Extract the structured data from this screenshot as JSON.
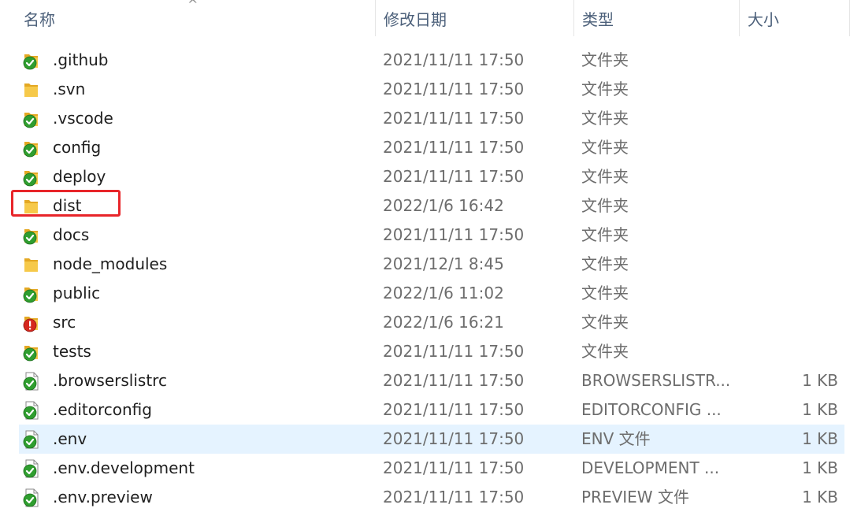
{
  "header": {
    "name": "名称",
    "date": "修改日期",
    "type": "类型",
    "size": "大小",
    "sort_arrow": "^"
  },
  "colors": {
    "folder": "#f6c94a",
    "folder_dark": "#e4a823",
    "status_ok": "#2f9e2f",
    "status_modified": "#d6281e",
    "selection": "#e5f3ff",
    "highlight_box": "#e8252a"
  },
  "rows": [
    {
      "name": ".github",
      "date": "2021/11/11 17:50",
      "type": "文件夹",
      "size": "",
      "kind": "folder",
      "status": "ok"
    },
    {
      "name": ".svn",
      "date": "2021/11/11 17:50",
      "type": "文件夹",
      "size": "",
      "kind": "folder",
      "status": "none"
    },
    {
      "name": ".vscode",
      "date": "2021/11/11 17:50",
      "type": "文件夹",
      "size": "",
      "kind": "folder",
      "status": "ok"
    },
    {
      "name": "config",
      "date": "2021/11/11 17:50",
      "type": "文件夹",
      "size": "",
      "kind": "folder",
      "status": "ok"
    },
    {
      "name": "deploy",
      "date": "2021/11/11 17:50",
      "type": "文件夹",
      "size": "",
      "kind": "folder",
      "status": "ok"
    },
    {
      "name": "dist",
      "date": "2022/1/6 16:42",
      "type": "文件夹",
      "size": "",
      "kind": "folder",
      "status": "none"
    },
    {
      "name": "docs",
      "date": "2021/11/11 17:50",
      "type": "文件夹",
      "size": "",
      "kind": "folder",
      "status": "ok"
    },
    {
      "name": "node_modules",
      "date": "2021/12/1 8:45",
      "type": "文件夹",
      "size": "",
      "kind": "folder",
      "status": "none"
    },
    {
      "name": "public",
      "date": "2022/1/6 11:02",
      "type": "文件夹",
      "size": "",
      "kind": "folder",
      "status": "ok"
    },
    {
      "name": "src",
      "date": "2022/1/6 16:21",
      "type": "文件夹",
      "size": "",
      "kind": "folder",
      "status": "modified"
    },
    {
      "name": "tests",
      "date": "2021/11/11 17:50",
      "type": "文件夹",
      "size": "",
      "kind": "folder",
      "status": "ok"
    },
    {
      "name": ".browserslistrc",
      "date": "2021/11/11 17:50",
      "type": "BROWSERSLISTR...",
      "size": "1 KB",
      "kind": "file",
      "status": "ok"
    },
    {
      "name": ".editorconfig",
      "date": "2021/11/11 17:50",
      "type": "EDITORCONFIG ...",
      "size": "1 KB",
      "kind": "file",
      "status": "ok"
    },
    {
      "name": ".env",
      "date": "2021/11/11 17:50",
      "type": "ENV 文件",
      "size": "1 KB",
      "kind": "file",
      "status": "ok",
      "selected": true
    },
    {
      "name": ".env.development",
      "date": "2021/11/11 17:50",
      "type": "DEVELOPMENT ...",
      "size": "1 KB",
      "kind": "file",
      "status": "ok"
    },
    {
      "name": ".env.preview",
      "date": "2021/11/11 17:50",
      "type": "PREVIEW 文件",
      "size": "1 KB",
      "kind": "file",
      "status": "ok"
    }
  ]
}
